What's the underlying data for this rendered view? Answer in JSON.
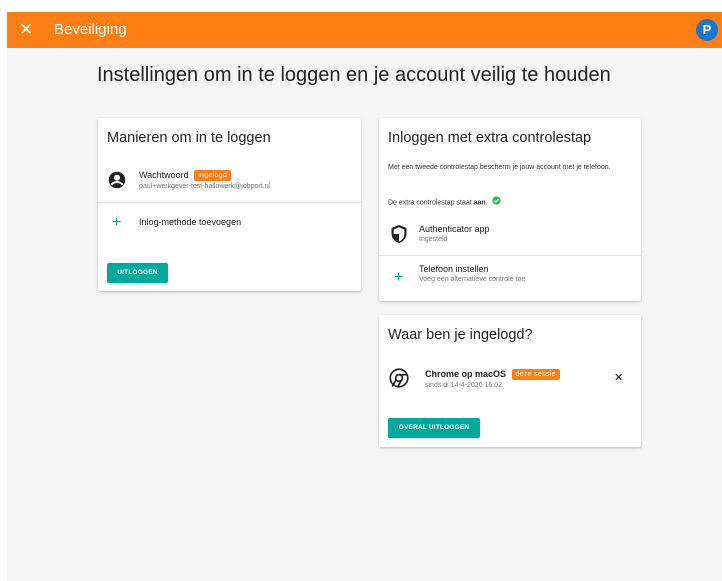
{
  "topbar": {
    "close_icon": "close-icon",
    "title": "Beveiliging",
    "avatar_letter": "P",
    "color": "#fd7e14"
  },
  "page_title": "Instellingen om in te loggen en je account veilig te houden",
  "login_methods": {
    "title": "Manieren om in te loggen",
    "password": {
      "icon": "account-circle-icon",
      "label": "Wachtwoord",
      "badge": "ingelogd",
      "email": "paul+werkgever-test-hallowerk@jobport.nl"
    },
    "add_method": {
      "icon": "plus-icon",
      "label": "Inlog-methode toevoegen"
    },
    "logout_button": "UITLOGGEN"
  },
  "two_step": {
    "title": "Inloggen met extra controlestap",
    "description": "Met een tweede controlestap bescherm je jouw account met je telefoon.",
    "status_prefix": "De extra controlestap staat ",
    "status_value": "aan",
    "status_suffix": ".",
    "status_icon": "check-circle-icon",
    "authenticator": {
      "icon": "shield-icon",
      "label": "Authenticator app",
      "sub": "Ingesteld"
    },
    "phone": {
      "icon": "plus-icon",
      "label": "Telefoon instellen",
      "sub": "Voeg een alternatieve controle toe"
    }
  },
  "sessions": {
    "title": "Waar ben je ingelogd?",
    "session": {
      "icon": "chrome-icon",
      "label": "Chrome op macOS",
      "badge": "deze sessie",
      "since": "sinds di 14-4-2020 16:02",
      "remove_icon": "close-icon"
    },
    "logout_everywhere_button": "OVERAL UITLOGGEN"
  },
  "colors": {
    "accent": "#fd7e14",
    "teal": "#00a89e",
    "avatar": "#1976d2",
    "check": "#2ebd59"
  }
}
